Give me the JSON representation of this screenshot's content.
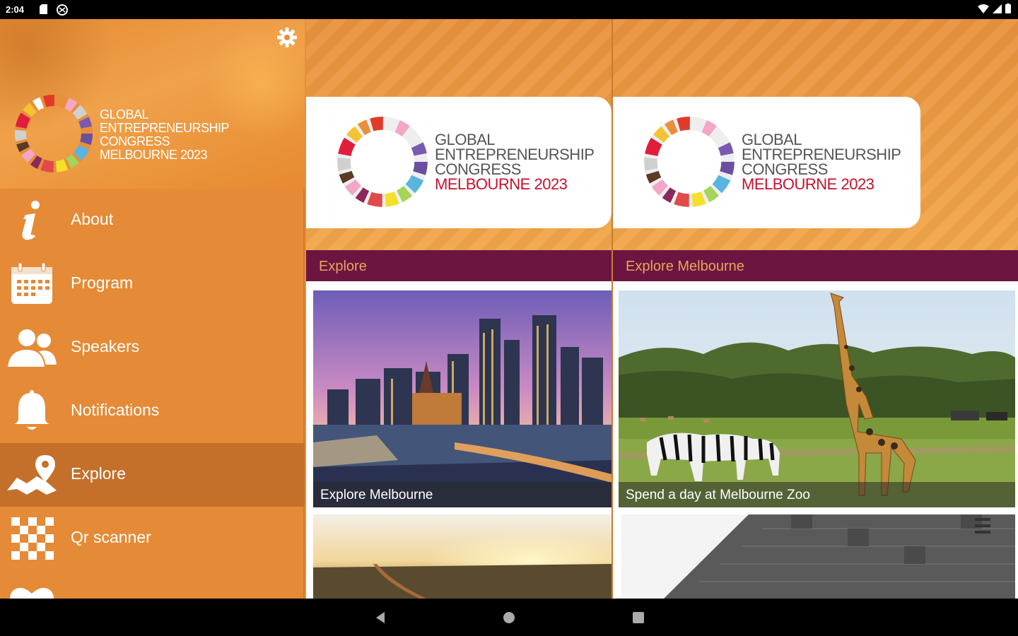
{
  "status_bar": {
    "time": "2:04"
  },
  "drawer": {
    "logo_lines": [
      "GLOBAL",
      "ENTREPRENEURSHIP",
      "CONGRESS",
      "MELBOURNE 2023"
    ],
    "items": [
      {
        "label": "About",
        "icon": "info-icon"
      },
      {
        "label": "Program",
        "icon": "calendar-icon"
      },
      {
        "label": "Speakers",
        "icon": "people-icon"
      },
      {
        "label": "Notifications",
        "icon": "bell-icon"
      },
      {
        "label": "Explore",
        "icon": "map-pin-icon",
        "active": true
      },
      {
        "label": "Qr scanner",
        "icon": "qr-icon"
      }
    ]
  },
  "columns": [
    {
      "logo_lines": [
        "GLOBAL",
        "ENTREPRENEURSHIP",
        "CONGRESS",
        "MELBOURNE 2023"
      ],
      "section_title": "Explore",
      "tile_caption": "Explore Melbourne"
    },
    {
      "logo_lines": [
        "GLOBAL",
        "ENTREPRENEURSHIP",
        "CONGRESS",
        "MELBOURNE 2023"
      ],
      "section_title": "Explore Melbourne",
      "tile_caption": "Spend a day at Melbourne Zoo"
    }
  ],
  "colors": {
    "accent_orange": "#e58a36",
    "section_bar": "#6d1541",
    "section_text": "#e9a55a",
    "logo_red": "#c8102e"
  }
}
